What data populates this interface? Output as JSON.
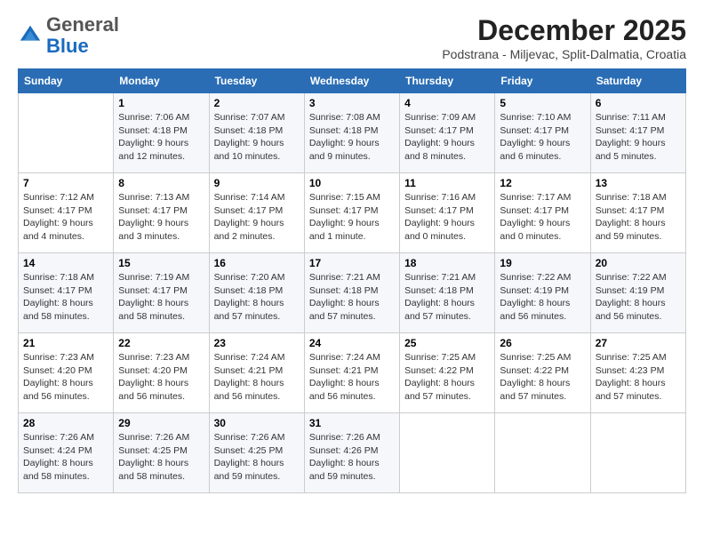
{
  "header": {
    "logo_line1": "General",
    "logo_line2": "Blue",
    "month": "December 2025",
    "location": "Podstrana - Miljevac, Split-Dalmatia, Croatia"
  },
  "weekdays": [
    "Sunday",
    "Monday",
    "Tuesday",
    "Wednesday",
    "Thursday",
    "Friday",
    "Saturday"
  ],
  "weeks": [
    [
      {
        "day": "",
        "info": ""
      },
      {
        "day": "1",
        "info": "Sunrise: 7:06 AM\nSunset: 4:18 PM\nDaylight: 9 hours\nand 12 minutes."
      },
      {
        "day": "2",
        "info": "Sunrise: 7:07 AM\nSunset: 4:18 PM\nDaylight: 9 hours\nand 10 minutes."
      },
      {
        "day": "3",
        "info": "Sunrise: 7:08 AM\nSunset: 4:18 PM\nDaylight: 9 hours\nand 9 minutes."
      },
      {
        "day": "4",
        "info": "Sunrise: 7:09 AM\nSunset: 4:17 PM\nDaylight: 9 hours\nand 8 minutes."
      },
      {
        "day": "5",
        "info": "Sunrise: 7:10 AM\nSunset: 4:17 PM\nDaylight: 9 hours\nand 6 minutes."
      },
      {
        "day": "6",
        "info": "Sunrise: 7:11 AM\nSunset: 4:17 PM\nDaylight: 9 hours\nand 5 minutes."
      }
    ],
    [
      {
        "day": "7",
        "info": "Sunrise: 7:12 AM\nSunset: 4:17 PM\nDaylight: 9 hours\nand 4 minutes."
      },
      {
        "day": "8",
        "info": "Sunrise: 7:13 AM\nSunset: 4:17 PM\nDaylight: 9 hours\nand 3 minutes."
      },
      {
        "day": "9",
        "info": "Sunrise: 7:14 AM\nSunset: 4:17 PM\nDaylight: 9 hours\nand 2 minutes."
      },
      {
        "day": "10",
        "info": "Sunrise: 7:15 AM\nSunset: 4:17 PM\nDaylight: 9 hours\nand 1 minute."
      },
      {
        "day": "11",
        "info": "Sunrise: 7:16 AM\nSunset: 4:17 PM\nDaylight: 9 hours\nand 0 minutes."
      },
      {
        "day": "12",
        "info": "Sunrise: 7:17 AM\nSunset: 4:17 PM\nDaylight: 9 hours\nand 0 minutes."
      },
      {
        "day": "13",
        "info": "Sunrise: 7:18 AM\nSunset: 4:17 PM\nDaylight: 8 hours\nand 59 minutes."
      }
    ],
    [
      {
        "day": "14",
        "info": "Sunrise: 7:18 AM\nSunset: 4:17 PM\nDaylight: 8 hours\nand 58 minutes."
      },
      {
        "day": "15",
        "info": "Sunrise: 7:19 AM\nSunset: 4:17 PM\nDaylight: 8 hours\nand 58 minutes."
      },
      {
        "day": "16",
        "info": "Sunrise: 7:20 AM\nSunset: 4:18 PM\nDaylight: 8 hours\nand 57 minutes."
      },
      {
        "day": "17",
        "info": "Sunrise: 7:21 AM\nSunset: 4:18 PM\nDaylight: 8 hours\nand 57 minutes."
      },
      {
        "day": "18",
        "info": "Sunrise: 7:21 AM\nSunset: 4:18 PM\nDaylight: 8 hours\nand 57 minutes."
      },
      {
        "day": "19",
        "info": "Sunrise: 7:22 AM\nSunset: 4:19 PM\nDaylight: 8 hours\nand 56 minutes."
      },
      {
        "day": "20",
        "info": "Sunrise: 7:22 AM\nSunset: 4:19 PM\nDaylight: 8 hours\nand 56 minutes."
      }
    ],
    [
      {
        "day": "21",
        "info": "Sunrise: 7:23 AM\nSunset: 4:20 PM\nDaylight: 8 hours\nand 56 minutes."
      },
      {
        "day": "22",
        "info": "Sunrise: 7:23 AM\nSunset: 4:20 PM\nDaylight: 8 hours\nand 56 minutes."
      },
      {
        "day": "23",
        "info": "Sunrise: 7:24 AM\nSunset: 4:21 PM\nDaylight: 8 hours\nand 56 minutes."
      },
      {
        "day": "24",
        "info": "Sunrise: 7:24 AM\nSunset: 4:21 PM\nDaylight: 8 hours\nand 56 minutes."
      },
      {
        "day": "25",
        "info": "Sunrise: 7:25 AM\nSunset: 4:22 PM\nDaylight: 8 hours\nand 57 minutes."
      },
      {
        "day": "26",
        "info": "Sunrise: 7:25 AM\nSunset: 4:22 PM\nDaylight: 8 hours\nand 57 minutes."
      },
      {
        "day": "27",
        "info": "Sunrise: 7:25 AM\nSunset: 4:23 PM\nDaylight: 8 hours\nand 57 minutes."
      }
    ],
    [
      {
        "day": "28",
        "info": "Sunrise: 7:26 AM\nSunset: 4:24 PM\nDaylight: 8 hours\nand 58 minutes."
      },
      {
        "day": "29",
        "info": "Sunrise: 7:26 AM\nSunset: 4:25 PM\nDaylight: 8 hours\nand 58 minutes."
      },
      {
        "day": "30",
        "info": "Sunrise: 7:26 AM\nSunset: 4:25 PM\nDaylight: 8 hours\nand 59 minutes."
      },
      {
        "day": "31",
        "info": "Sunrise: 7:26 AM\nSunset: 4:26 PM\nDaylight: 8 hours\nand 59 minutes."
      },
      {
        "day": "",
        "info": ""
      },
      {
        "day": "",
        "info": ""
      },
      {
        "day": "",
        "info": ""
      }
    ]
  ]
}
